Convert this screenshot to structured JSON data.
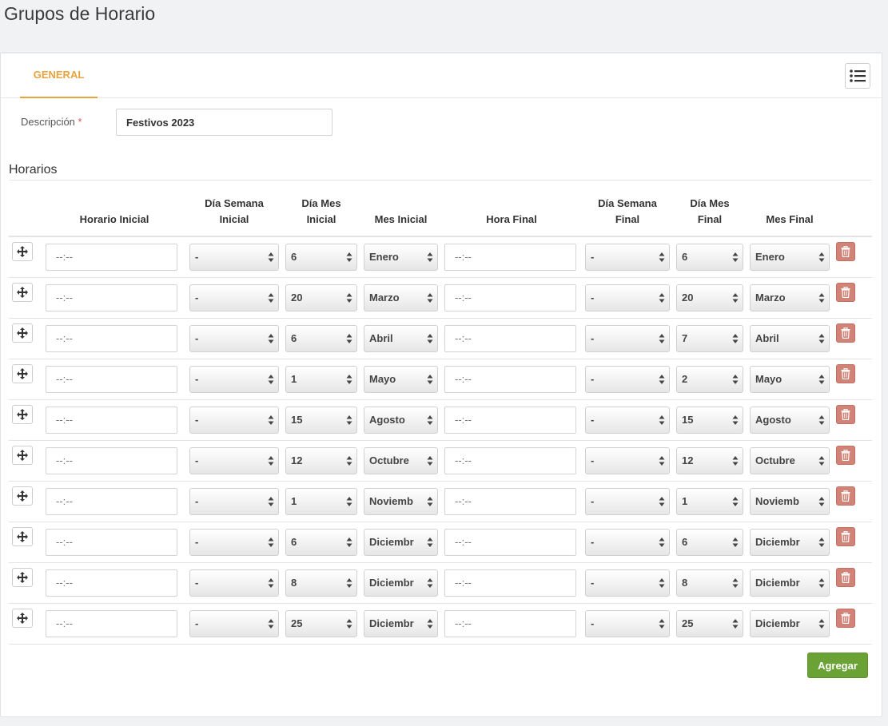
{
  "page": {
    "title": "Grupos de Horario"
  },
  "tabs": {
    "general": "GENERAL"
  },
  "form": {
    "description_label": "Descripción",
    "required_mark": "*",
    "description_value": "Festivos 2023"
  },
  "section": {
    "title": "Horarios"
  },
  "table": {
    "headers": {
      "start_time": "Horario Inicial",
      "start_weekday_1": "Día Semana",
      "start_weekday_2": "Inicial",
      "start_monthday_1": "Día Mes",
      "start_monthday_2": "Inicial",
      "start_month": "Mes Inicial",
      "end_time": "Hora Final",
      "end_weekday_1": "Día Semana",
      "end_weekday_2": "Final",
      "end_monthday_1": "Día Mes",
      "end_monthday_2": "Final",
      "end_month": "Mes Final"
    },
    "time_placeholder": "--:--",
    "rows": [
      {
        "start_weekday": "-",
        "start_day": "6",
        "start_month": "Enero",
        "end_weekday": "-",
        "end_day": "6",
        "end_month": "Enero"
      },
      {
        "start_weekday": "-",
        "start_day": "20",
        "start_month": "Marzo",
        "end_weekday": "-",
        "end_day": "20",
        "end_month": "Marzo"
      },
      {
        "start_weekday": "-",
        "start_day": "6",
        "start_month": "Abril",
        "end_weekday": "-",
        "end_day": "7",
        "end_month": "Abril"
      },
      {
        "start_weekday": "-",
        "start_day": "1",
        "start_month": "Mayo",
        "end_weekday": "-",
        "end_day": "2",
        "end_month": "Mayo"
      },
      {
        "start_weekday": "-",
        "start_day": "15",
        "start_month": "Agosto",
        "end_weekday": "-",
        "end_day": "15",
        "end_month": "Agosto"
      },
      {
        "start_weekday": "-",
        "start_day": "12",
        "start_month": "Octubre",
        "end_weekday": "-",
        "end_day": "12",
        "end_month": "Octubre"
      },
      {
        "start_weekday": "-",
        "start_day": "1",
        "start_month": "Noviemb",
        "end_weekday": "-",
        "end_day": "1",
        "end_month": "Noviemb"
      },
      {
        "start_weekday": "-",
        "start_day": "6",
        "start_month": "Diciembr",
        "end_weekday": "-",
        "end_day": "6",
        "end_month": "Diciembr"
      },
      {
        "start_weekday": "-",
        "start_day": "8",
        "start_month": "Diciembr",
        "end_weekday": "-",
        "end_day": "8",
        "end_month": "Diciembr"
      },
      {
        "start_weekday": "-",
        "start_day": "25",
        "start_month": "Diciembr",
        "end_weekday": "-",
        "end_day": "25",
        "end_month": "Diciembr"
      }
    ]
  },
  "actions": {
    "add_label": "Agregar"
  },
  "colors": {
    "accent": "#e8a33c",
    "add_button": "#6aa236",
    "delete_button": "#d18377"
  },
  "icons": {
    "list": "list-icon",
    "move": "move-icon",
    "delete": "trash-icon",
    "select_arrows": "select-arrows-icon"
  }
}
